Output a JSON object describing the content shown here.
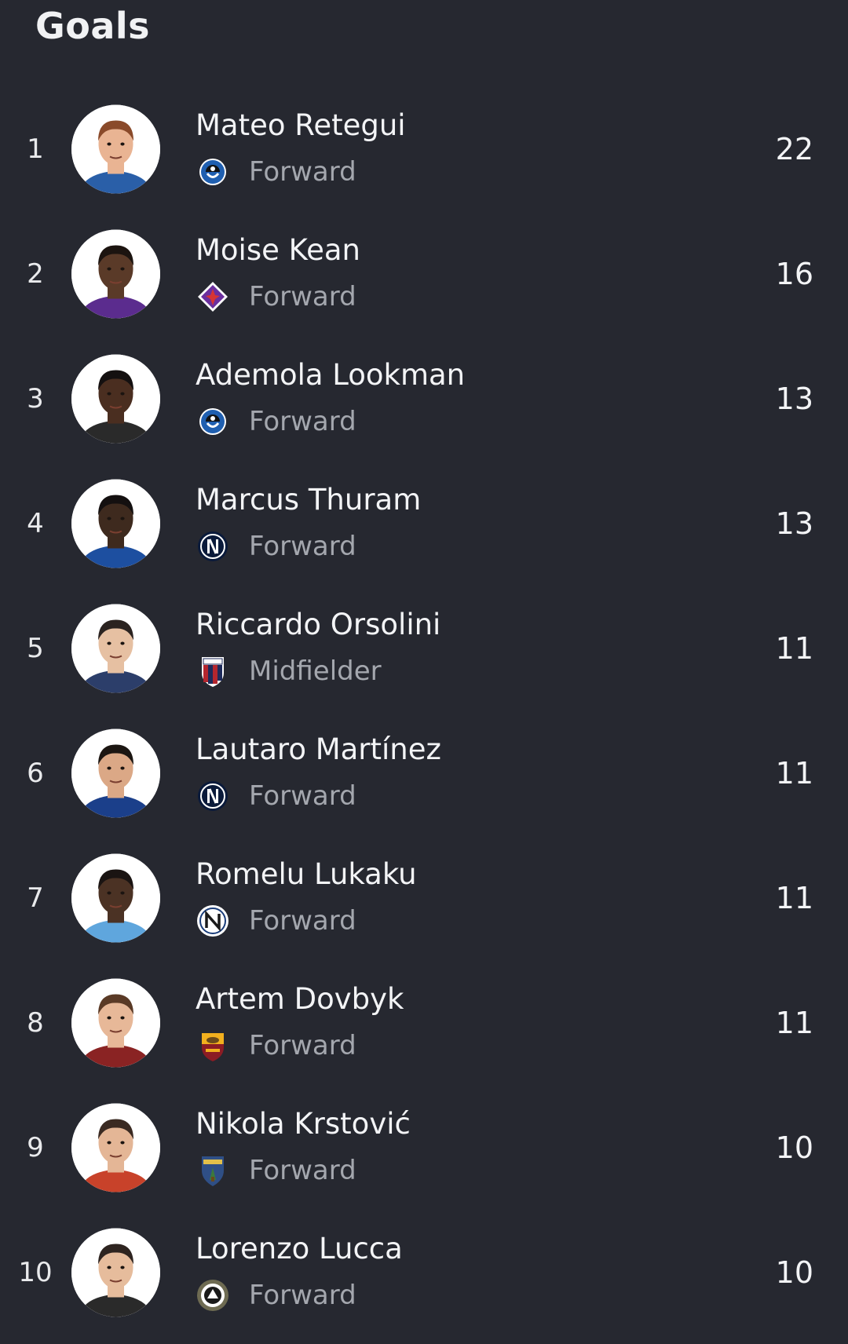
{
  "header": {
    "title": "Goals"
  },
  "players": [
    {
      "rank": "1",
      "name": "Mateo Retegui",
      "position": "Forward",
      "goals": "22",
      "club_icon": "atalanta-crest-icon",
      "skin": "#e9b493",
      "hair": "#8a4a2a",
      "shirt": "#2a5fa8"
    },
    {
      "rank": "2",
      "name": "Moise Kean",
      "position": "Forward",
      "goals": "16",
      "club_icon": "fiorentina-crest-icon",
      "skin": "#5a3a28",
      "hair": "#1c1410",
      "shirt": "#5b2c8e"
    },
    {
      "rank": "3",
      "name": "Ademola Lookman",
      "position": "Forward",
      "goals": "13",
      "club_icon": "atalanta-crest-icon",
      "skin": "#4a2e20",
      "hair": "#141010",
      "shirt": "#2a2a2a"
    },
    {
      "rank": "4",
      "name": "Marcus Thuram",
      "position": "Forward",
      "goals": "13",
      "club_icon": "inter-crest-icon",
      "skin": "#3e2a1e",
      "hair": "#141010",
      "shirt": "#1d4fa0"
    },
    {
      "rank": "5",
      "name": "Riccardo Orsolini",
      "position": "Midfielder",
      "goals": "11",
      "club_icon": "bologna-crest-icon",
      "skin": "#e6c0a2",
      "hair": "#2b2320",
      "shirt": "#2c3e6a"
    },
    {
      "rank": "6",
      "name": "Lautaro Martínez",
      "position": "Forward",
      "goals": "11",
      "club_icon": "inter-crest-icon",
      "skin": "#dba886",
      "hair": "#1c1612",
      "shirt": "#1b3f8a"
    },
    {
      "rank": "7",
      "name": "Romelu Lukaku",
      "position": "Forward",
      "goals": "11",
      "club_icon": "napoli-crest-icon",
      "skin": "#4b3224",
      "hair": "#1a1412",
      "shirt": "#5fa6dd"
    },
    {
      "rank": "8",
      "name": "Artem Dovbyk",
      "position": "Forward",
      "goals": "11",
      "club_icon": "roma-crest-icon",
      "skin": "#e7b898",
      "hair": "#5a3a26",
      "shirt": "#8a2323"
    },
    {
      "rank": "9",
      "name": "Nikola Krstović",
      "position": "Forward",
      "goals": "10",
      "club_icon": "lecce-crest-icon",
      "skin": "#e4b696",
      "hair": "#3a2a22",
      "shirt": "#c8422a"
    },
    {
      "rank": "10",
      "name": "Lorenzo Lucca",
      "position": "Forward",
      "goals": "10",
      "club_icon": "udinese-crest-icon",
      "skin": "#e6bc9c",
      "hair": "#2e2420",
      "shirt": "#2a2a2a"
    }
  ]
}
